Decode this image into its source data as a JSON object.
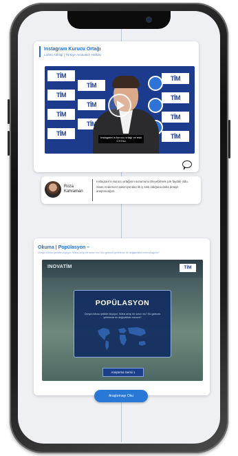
{
  "post1": {
    "title": "Instagram Kurucu Ortağı",
    "subtitle": "Lütfen Altbilgi | Türkiye Avukatları Haftası",
    "video": {
      "logo_text": "TİM",
      "caption": "Instagram'ın kurucu ortağı ve eski CTO'su"
    }
  },
  "quote_card": {
    "author": "Roza Kahraman",
    "paragraph1": "Instagram'ın kurucu ortağının sunumunu izleyebilmek çok faydalı oldu.",
    "paragraph2": "Sivas Anderson'ı takımıyondan ilk iş kılık oldığuna daha detaylı araştıracağım."
  },
  "post2": {
    "title": "Okuma | Popülasyon –",
    "subtitle": "Dünya nüfusu şekilde büyüyor. Nüfus artışı bir sorun mu? Bu gelecek şehirlerde bir değişiklikler mevcut ağırlık?",
    "poster": {
      "brand_left": "INOVATİM",
      "brand_right": "TİM",
      "heading": "POPÜLASYON",
      "description": "Dünya nüfusu şekilde büyüyor. Nüfus artışı bir sorun mu? Bu gelecek şehirlerde bir değişiklikler mevcut?",
      "button_label": "Araştırma Serisi 1"
    }
  },
  "cta_label": "Araştırmayı Oku",
  "colors": {
    "accent": "#2a78d6",
    "title_blue": "#1f6fd1",
    "video_bg": "#1d3b8c",
    "poster_box": "#112d60"
  }
}
